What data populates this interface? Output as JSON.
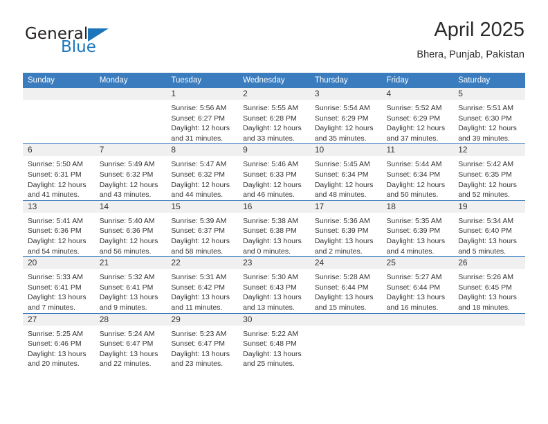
{
  "brand": {
    "name_part1": "General",
    "name_part2": "Blue",
    "triangle_icon": "triangle-icon",
    "color_dark": "#231f20",
    "color_blue": "#1b75bb"
  },
  "header": {
    "title": "April 2025",
    "location": "Bhera, Punjab, Pakistan"
  },
  "theme": {
    "header_bg": "#3a7cbe",
    "header_text": "#ffffff",
    "daynum_bg": "#f0f0f0",
    "cell_bg": "#ffffff",
    "row_divider": "#3a7cbe"
  },
  "weekdays": [
    "Sunday",
    "Monday",
    "Tuesday",
    "Wednesday",
    "Thursday",
    "Friday",
    "Saturday"
  ],
  "labels": {
    "sunrise_prefix": "Sunrise:",
    "sunset_prefix": "Sunset:",
    "daylight_prefix": "Daylight:"
  },
  "weeks": [
    [
      {
        "day": "",
        "blank": true
      },
      {
        "day": "",
        "blank": true
      },
      {
        "day": "1",
        "sunrise": "Sunrise: 5:56 AM",
        "sunset": "Sunset: 6:27 PM",
        "daylight": "Daylight: 12 hours and 31 minutes."
      },
      {
        "day": "2",
        "sunrise": "Sunrise: 5:55 AM",
        "sunset": "Sunset: 6:28 PM",
        "daylight": "Daylight: 12 hours and 33 minutes."
      },
      {
        "day": "3",
        "sunrise": "Sunrise: 5:54 AM",
        "sunset": "Sunset: 6:29 PM",
        "daylight": "Daylight: 12 hours and 35 minutes."
      },
      {
        "day": "4",
        "sunrise": "Sunrise: 5:52 AM",
        "sunset": "Sunset: 6:29 PM",
        "daylight": "Daylight: 12 hours and 37 minutes."
      },
      {
        "day": "5",
        "sunrise": "Sunrise: 5:51 AM",
        "sunset": "Sunset: 6:30 PM",
        "daylight": "Daylight: 12 hours and 39 minutes."
      }
    ],
    [
      {
        "day": "6",
        "sunrise": "Sunrise: 5:50 AM",
        "sunset": "Sunset: 6:31 PM",
        "daylight": "Daylight: 12 hours and 41 minutes."
      },
      {
        "day": "7",
        "sunrise": "Sunrise: 5:49 AM",
        "sunset": "Sunset: 6:32 PM",
        "daylight": "Daylight: 12 hours and 43 minutes."
      },
      {
        "day": "8",
        "sunrise": "Sunrise: 5:47 AM",
        "sunset": "Sunset: 6:32 PM",
        "daylight": "Daylight: 12 hours and 44 minutes."
      },
      {
        "day": "9",
        "sunrise": "Sunrise: 5:46 AM",
        "sunset": "Sunset: 6:33 PM",
        "daylight": "Daylight: 12 hours and 46 minutes."
      },
      {
        "day": "10",
        "sunrise": "Sunrise: 5:45 AM",
        "sunset": "Sunset: 6:34 PM",
        "daylight": "Daylight: 12 hours and 48 minutes."
      },
      {
        "day": "11",
        "sunrise": "Sunrise: 5:44 AM",
        "sunset": "Sunset: 6:34 PM",
        "daylight": "Daylight: 12 hours and 50 minutes."
      },
      {
        "day": "12",
        "sunrise": "Sunrise: 5:42 AM",
        "sunset": "Sunset: 6:35 PM",
        "daylight": "Daylight: 12 hours and 52 minutes."
      }
    ],
    [
      {
        "day": "13",
        "sunrise": "Sunrise: 5:41 AM",
        "sunset": "Sunset: 6:36 PM",
        "daylight": "Daylight: 12 hours and 54 minutes."
      },
      {
        "day": "14",
        "sunrise": "Sunrise: 5:40 AM",
        "sunset": "Sunset: 6:36 PM",
        "daylight": "Daylight: 12 hours and 56 minutes."
      },
      {
        "day": "15",
        "sunrise": "Sunrise: 5:39 AM",
        "sunset": "Sunset: 6:37 PM",
        "daylight": "Daylight: 12 hours and 58 minutes."
      },
      {
        "day": "16",
        "sunrise": "Sunrise: 5:38 AM",
        "sunset": "Sunset: 6:38 PM",
        "daylight": "Daylight: 13 hours and 0 minutes."
      },
      {
        "day": "17",
        "sunrise": "Sunrise: 5:36 AM",
        "sunset": "Sunset: 6:39 PM",
        "daylight": "Daylight: 13 hours and 2 minutes."
      },
      {
        "day": "18",
        "sunrise": "Sunrise: 5:35 AM",
        "sunset": "Sunset: 6:39 PM",
        "daylight": "Daylight: 13 hours and 4 minutes."
      },
      {
        "day": "19",
        "sunrise": "Sunrise: 5:34 AM",
        "sunset": "Sunset: 6:40 PM",
        "daylight": "Daylight: 13 hours and 5 minutes."
      }
    ],
    [
      {
        "day": "20",
        "sunrise": "Sunrise: 5:33 AM",
        "sunset": "Sunset: 6:41 PM",
        "daylight": "Daylight: 13 hours and 7 minutes."
      },
      {
        "day": "21",
        "sunrise": "Sunrise: 5:32 AM",
        "sunset": "Sunset: 6:41 PM",
        "daylight": "Daylight: 13 hours and 9 minutes."
      },
      {
        "day": "22",
        "sunrise": "Sunrise: 5:31 AM",
        "sunset": "Sunset: 6:42 PM",
        "daylight": "Daylight: 13 hours and 11 minutes."
      },
      {
        "day": "23",
        "sunrise": "Sunrise: 5:30 AM",
        "sunset": "Sunset: 6:43 PM",
        "daylight": "Daylight: 13 hours and 13 minutes."
      },
      {
        "day": "24",
        "sunrise": "Sunrise: 5:28 AM",
        "sunset": "Sunset: 6:44 PM",
        "daylight": "Daylight: 13 hours and 15 minutes."
      },
      {
        "day": "25",
        "sunrise": "Sunrise: 5:27 AM",
        "sunset": "Sunset: 6:44 PM",
        "daylight": "Daylight: 13 hours and 16 minutes."
      },
      {
        "day": "26",
        "sunrise": "Sunrise: 5:26 AM",
        "sunset": "Sunset: 6:45 PM",
        "daylight": "Daylight: 13 hours and 18 minutes."
      }
    ],
    [
      {
        "day": "27",
        "sunrise": "Sunrise: 5:25 AM",
        "sunset": "Sunset: 6:46 PM",
        "daylight": "Daylight: 13 hours and 20 minutes."
      },
      {
        "day": "28",
        "sunrise": "Sunrise: 5:24 AM",
        "sunset": "Sunset: 6:47 PM",
        "daylight": "Daylight: 13 hours and 22 minutes."
      },
      {
        "day": "29",
        "sunrise": "Sunrise: 5:23 AM",
        "sunset": "Sunset: 6:47 PM",
        "daylight": "Daylight: 13 hours and 23 minutes."
      },
      {
        "day": "30",
        "sunrise": "Sunrise: 5:22 AM",
        "sunset": "Sunset: 6:48 PM",
        "daylight": "Daylight: 13 hours and 25 minutes."
      },
      {
        "day": "",
        "blank": true
      },
      {
        "day": "",
        "blank": true
      },
      {
        "day": "",
        "blank": true
      }
    ]
  ]
}
